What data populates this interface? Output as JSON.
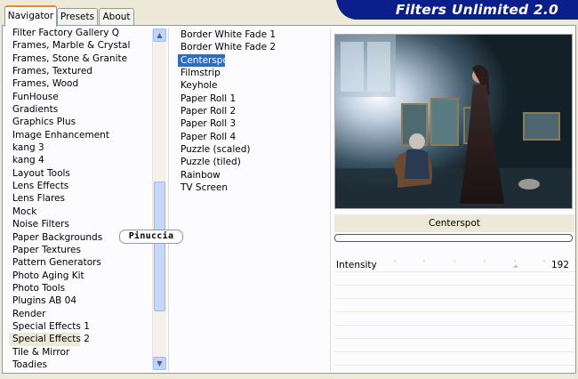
{
  "tabs": [
    "Navigator",
    "Presets",
    "About"
  ],
  "banner_title": "Filters Unlimited 2.0",
  "categories": [
    "Filter Factory Gallery Q",
    "Frames, Marble & Crystal",
    "Frames, Stone & Granite",
    "Frames, Textured",
    "Frames, Wood",
    "FunHouse",
    "Gradients",
    "Graphics Plus",
    "Image Enhancement",
    "kang 3",
    "kang 4",
    "Layout Tools",
    "Lens Effects",
    "Lens Flares",
    "Mock",
    "Noise Filters",
    "Paper Backgrounds",
    "Paper Textures",
    "Pattern Generators",
    "Photo Aging Kit",
    "Photo Tools",
    "Plugins AB 04",
    "Render",
    "Special Effects 1",
    "Special Effects 2",
    "Tile & Mirror",
    "Toadies"
  ],
  "highlighted_category": "Special Effects 2",
  "filters": [
    "Border White Fade 1",
    "Border White Fade 2",
    "Centerspot",
    "Filmstrip",
    "Keyhole",
    "Paper Roll 1",
    "Paper Roll 2",
    "Paper Roll 3",
    "Paper Roll 4",
    "Puzzle (scaled)",
    "Puzzle (tiled)",
    "Rainbow",
    "TV Screen"
  ],
  "selected_filter": "Centerspot",
  "filter_name_display": "Centerspot",
  "parameters": [
    {
      "label": "Intensity",
      "value": "192"
    }
  ],
  "watermark": "Pinuccia",
  "colors": {
    "accent_tab": "#e68b2c",
    "selection": "#316ac5",
    "banner": "#0a1f8a"
  },
  "icons": {
    "scroll_up": "chevron-up-icon",
    "scroll_down": "chevron-down-icon"
  }
}
